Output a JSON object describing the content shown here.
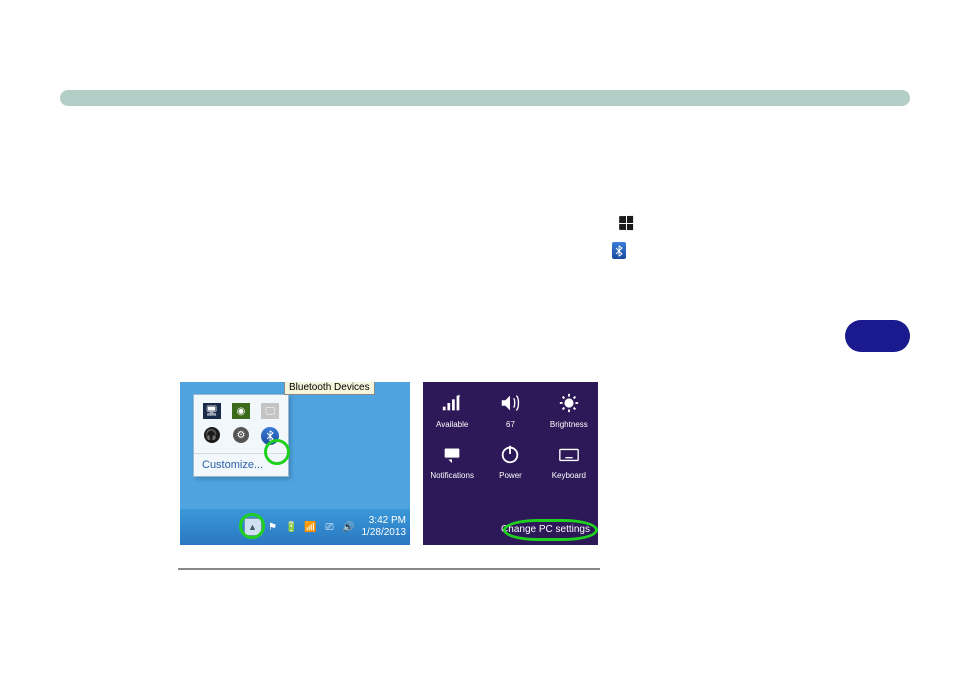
{
  "tooltip": {
    "text": "Bluetooth Devices"
  },
  "tray_popup": {
    "customize_label": "Customize...",
    "icons": {
      "i1": "monitor",
      "i2": "nvidia",
      "i3": "monitor2",
      "i4": "headset",
      "i5": "gear",
      "i6": "bluetooth"
    }
  },
  "taskbar": {
    "time": "3:42 PM",
    "date": "1/28/2013"
  },
  "charms": {
    "items": [
      {
        "label": "Available",
        "icon": "signal"
      },
      {
        "label": "67",
        "icon": "volume"
      },
      {
        "label": "Brightness",
        "icon": "brightness"
      },
      {
        "label": "Notifications",
        "icon": "notifications"
      },
      {
        "label": "Power",
        "icon": "power"
      },
      {
        "label": "Keyboard",
        "icon": "keyboard"
      }
    ],
    "change_pc_label": "Change PC settings"
  }
}
